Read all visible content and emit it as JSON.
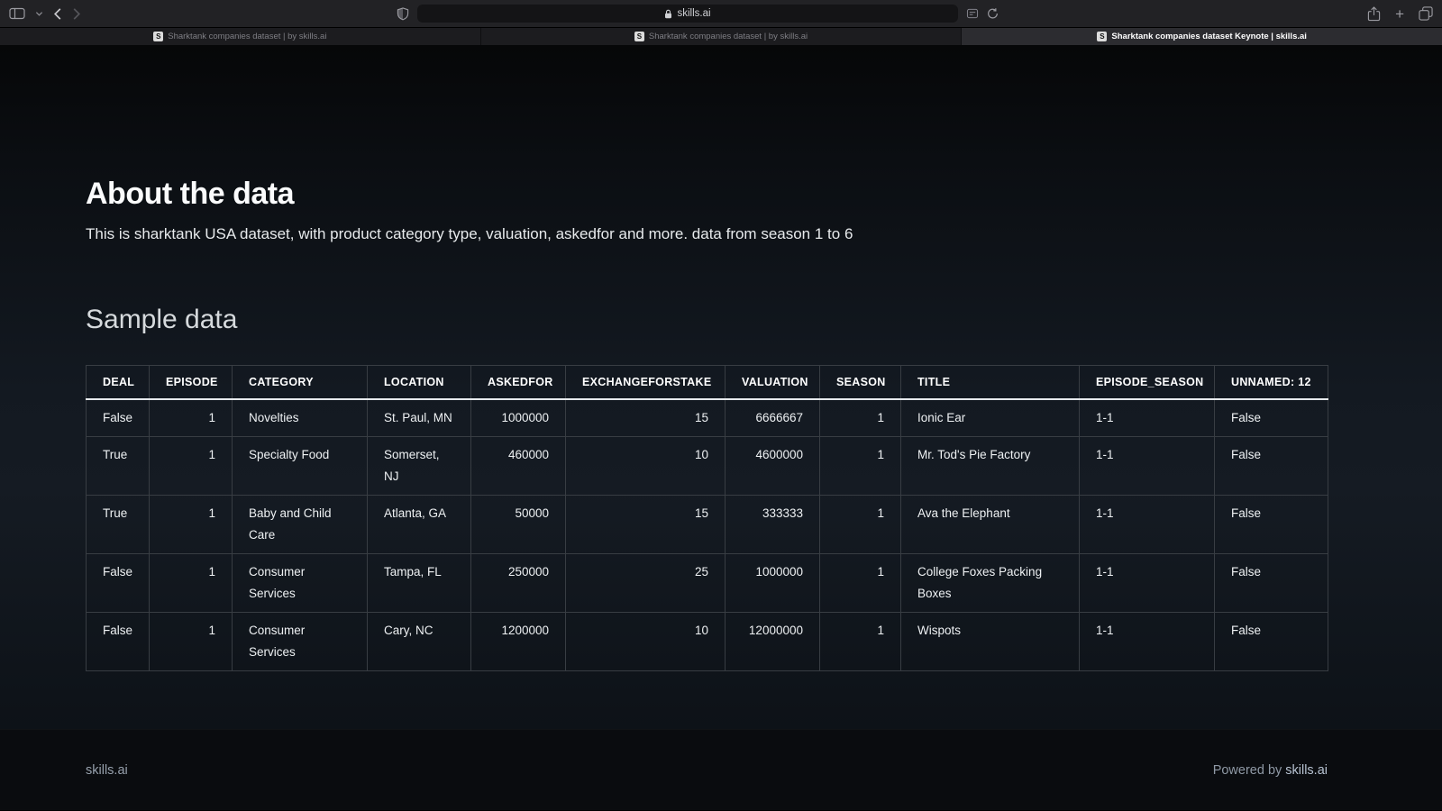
{
  "colors": {
    "chrome_bg": "#222225",
    "page_gradient_mid": "#151b23",
    "table_border": "#383d43",
    "header_underline": "#e6e9ec",
    "footer_link": "#b7c3d2"
  },
  "browser": {
    "favicon_letter": "S",
    "address": {
      "url": "skills.ai"
    },
    "toolbar": {
      "new_tab_glyph": "+"
    },
    "tabs": [
      {
        "title": "Sharktank companies dataset | by skills.ai",
        "active": false
      },
      {
        "title": "Sharktank companies dataset | by skills.ai",
        "active": false
      },
      {
        "title": "Sharktank companies dataset Keynote | skills.ai",
        "active": true
      }
    ]
  },
  "page": {
    "about": {
      "title": "About the data",
      "description": "This is sharktank USA dataset, with product category type, valuation, askedfor and more. data from season 1 to 6"
    },
    "sample": {
      "title": "Sample data"
    },
    "footer": {
      "brand": "skills.ai",
      "powered_prefix": "Powered by",
      "powered_link": "skills.ai"
    }
  },
  "table": {
    "columns": [
      {
        "label": "DEAL",
        "align": "left"
      },
      {
        "label": "EPISODE",
        "align": "right"
      },
      {
        "label": "CATEGORY",
        "align": "left"
      },
      {
        "label": "LOCATION",
        "align": "left"
      },
      {
        "label": "ASKEDFOR",
        "align": "right"
      },
      {
        "label": "EXCHANGEFORSTAKE",
        "align": "right"
      },
      {
        "label": "VALUATION",
        "align": "right"
      },
      {
        "label": "SEASON",
        "align": "right"
      },
      {
        "label": "TITLE",
        "align": "left"
      },
      {
        "label": "EPISODE_SEASON",
        "align": "left"
      },
      {
        "label": "UNNAMED: 12",
        "align": "left"
      }
    ],
    "rows": [
      [
        "False",
        "1",
        "Novelties",
        "St. Paul, MN",
        "1000000",
        "15",
        "6666667",
        "1",
        "Ionic Ear",
        "1-1",
        "False"
      ],
      [
        "True",
        "1",
        "Specialty Food",
        "Somerset, NJ",
        "460000",
        "10",
        "4600000",
        "1",
        "Mr. Tod's Pie Factory",
        "1-1",
        "False"
      ],
      [
        "True",
        "1",
        "Baby and Child Care",
        "Atlanta, GA",
        "50000",
        "15",
        "333333",
        "1",
        "Ava the Elephant",
        "1-1",
        "False"
      ],
      [
        "False",
        "1",
        "Consumer Services",
        "Tampa, FL",
        "250000",
        "25",
        "1000000",
        "1",
        "College Foxes Packing Boxes",
        "1-1",
        "False"
      ],
      [
        "False",
        "1",
        "Consumer Services",
        "Cary, NC",
        "1200000",
        "10",
        "12000000",
        "1",
        "Wispots",
        "1-1",
        "False"
      ]
    ]
  }
}
